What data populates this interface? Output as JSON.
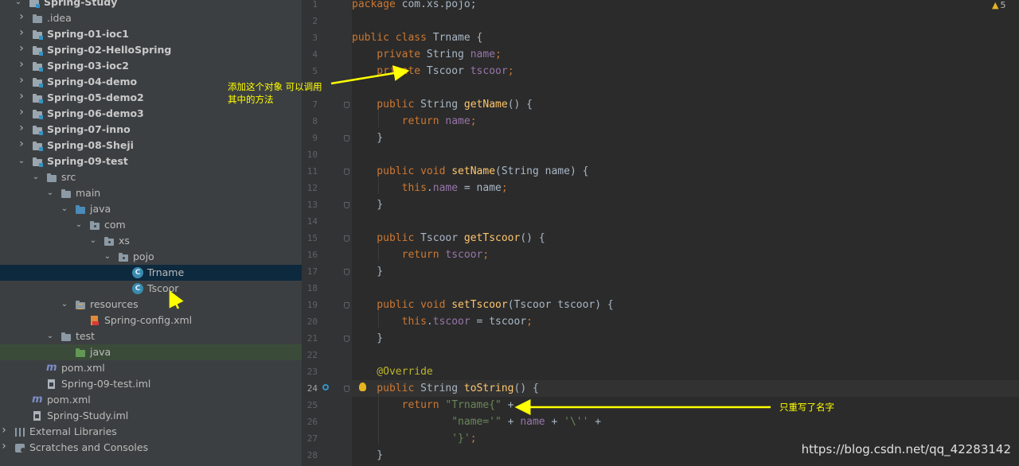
{
  "project_tree": {
    "rows": [
      {
        "label": "Spring-Study",
        "path": "C:\\Users\\相生\\IdeaProjects\\Spring-Study",
        "icon": "module-folder-icon",
        "chevron": "down",
        "bold": true
      },
      {
        "label": ".idea",
        "icon": "folder-icon",
        "chevron": "right"
      },
      {
        "label": "Spring-01-ioc1",
        "icon": "module-folder-icon",
        "chevron": "right",
        "bold": true
      },
      {
        "label": "Spring-02-HelloSpring",
        "icon": "module-folder-icon",
        "chevron": "right",
        "bold": true
      },
      {
        "label": "Spring-03-ioc2",
        "icon": "module-folder-icon",
        "chevron": "right",
        "bold": true
      },
      {
        "label": "Spring-04-demo",
        "icon": "module-folder-icon",
        "chevron": "right",
        "bold": true
      },
      {
        "label": "Spring-05-demo2",
        "icon": "module-folder-icon",
        "chevron": "right",
        "bold": true
      },
      {
        "label": "Spring-06-demo3",
        "icon": "module-folder-icon",
        "chevron": "right",
        "bold": true
      },
      {
        "label": "Spring-07-inno",
        "icon": "module-folder-icon",
        "chevron": "right",
        "bold": true
      },
      {
        "label": "Spring-08-Sheji",
        "icon": "module-folder-icon",
        "chevron": "right",
        "bold": true
      },
      {
        "label": "Spring-09-test",
        "icon": "module-folder-icon",
        "chevron": "down",
        "bold": true
      },
      {
        "label": "src",
        "icon": "folder-icon",
        "chevron": "down"
      },
      {
        "label": "main",
        "icon": "folder-icon",
        "chevron": "down"
      },
      {
        "label": "java",
        "icon": "source-folder-icon",
        "chevron": "down"
      },
      {
        "label": "com",
        "icon": "package-icon",
        "chevron": "down"
      },
      {
        "label": "xs",
        "icon": "package-icon",
        "chevron": "down"
      },
      {
        "label": "pojo",
        "icon": "package-icon",
        "chevron": "down"
      },
      {
        "label": "Trname",
        "icon": "class-icon",
        "selected": true
      },
      {
        "label": "Tscoor",
        "icon": "class-icon"
      },
      {
        "label": "resources",
        "icon": "resources-folder-icon",
        "chevron": "down"
      },
      {
        "label": "Spring-config.xml",
        "icon": "spring-xml-icon"
      },
      {
        "label": "test",
        "icon": "folder-icon",
        "chevron": "down"
      },
      {
        "label": "java",
        "icon": "test-folder-icon",
        "highlight": true
      },
      {
        "label": "pom.xml",
        "icon": "maven-icon"
      },
      {
        "label": "Spring-09-test.iml",
        "icon": "iml-file-icon"
      },
      {
        "label": "pom.xml",
        "icon": "maven-icon"
      },
      {
        "label": "Spring-Study.iml",
        "icon": "iml-file-icon"
      },
      {
        "label": "External Libraries",
        "icon": "libraries-icon",
        "chevron": "right"
      },
      {
        "label": "Scratches and Consoles",
        "icon": "scratches-icon",
        "chevron": "right"
      }
    ]
  },
  "editor": {
    "current_line": 24,
    "warnings_count": "5",
    "lines": [
      {
        "n": "1",
        "tokens": [
          [
            "kw",
            "package "
          ],
          [
            "plain",
            "com.xs.pojo;"
          ]
        ]
      },
      {
        "n": "2",
        "tokens": []
      },
      {
        "n": "3",
        "tokens": [
          [
            "kw",
            "public class "
          ],
          [
            "plain",
            "Trname {"
          ]
        ]
      },
      {
        "n": "4",
        "tokens": [
          [
            "kw",
            "    private "
          ],
          [
            "plain",
            "String "
          ],
          [
            "fld",
            "name"
          ],
          [
            "kw",
            ";"
          ]
        ]
      },
      {
        "n": "5",
        "tokens": [
          [
            "kw",
            "    private "
          ],
          [
            "plain",
            "Tscoor "
          ],
          [
            "fld",
            "tscoor"
          ],
          [
            "kw",
            ";"
          ]
        ]
      },
      {
        "n": "6",
        "tokens": []
      },
      {
        "n": "7",
        "tokens": [
          [
            "kw",
            "    public "
          ],
          [
            "plain",
            "String "
          ],
          [
            "mth",
            "getName"
          ],
          [
            "plain",
            "() {"
          ]
        ]
      },
      {
        "n": "8",
        "tokens": [
          [
            "kw",
            "        return "
          ],
          [
            "fld",
            "name"
          ],
          [
            "kw",
            ";"
          ]
        ]
      },
      {
        "n": "9",
        "tokens": [
          [
            "plain",
            "    }"
          ]
        ]
      },
      {
        "n": "10",
        "tokens": []
      },
      {
        "n": "11",
        "tokens": [
          [
            "kw",
            "    public void "
          ],
          [
            "mth",
            "setName"
          ],
          [
            "plain",
            "(String name) {"
          ]
        ]
      },
      {
        "n": "12",
        "tokens": [
          [
            "kw",
            "        this"
          ],
          [
            "plain",
            "."
          ],
          [
            "fld",
            "name"
          ],
          [
            "plain",
            " = name"
          ],
          [
            "kw",
            ";"
          ]
        ]
      },
      {
        "n": "13",
        "tokens": [
          [
            "plain",
            "    }"
          ]
        ]
      },
      {
        "n": "14",
        "tokens": []
      },
      {
        "n": "15",
        "tokens": [
          [
            "kw",
            "    public "
          ],
          [
            "plain",
            "Tscoor "
          ],
          [
            "mth",
            "getTscoor"
          ],
          [
            "plain",
            "() {"
          ]
        ]
      },
      {
        "n": "16",
        "tokens": [
          [
            "kw",
            "        return "
          ],
          [
            "fld",
            "tscoor"
          ],
          [
            "kw",
            ";"
          ]
        ]
      },
      {
        "n": "17",
        "tokens": [
          [
            "plain",
            "    }"
          ]
        ]
      },
      {
        "n": "18",
        "tokens": []
      },
      {
        "n": "19",
        "tokens": [
          [
            "kw",
            "    public void "
          ],
          [
            "mth",
            "setTscoor"
          ],
          [
            "plain",
            "(Tscoor tscoor) {"
          ]
        ]
      },
      {
        "n": "20",
        "tokens": [
          [
            "kw",
            "        this"
          ],
          [
            "plain",
            "."
          ],
          [
            "fld",
            "tscoor"
          ],
          [
            "plain",
            " = tscoor"
          ],
          [
            "kw",
            ";"
          ]
        ]
      },
      {
        "n": "21",
        "tokens": [
          [
            "plain",
            "    }"
          ]
        ]
      },
      {
        "n": "22",
        "tokens": []
      },
      {
        "n": "23",
        "tokens": [
          [
            "ann",
            "    @Override"
          ]
        ]
      },
      {
        "n": "24",
        "tokens": [
          [
            "kw",
            "    public "
          ],
          [
            "plain",
            "String "
          ],
          [
            "mth",
            "toString"
          ],
          [
            "plain",
            "() {"
          ]
        ]
      },
      {
        "n": "25",
        "tokens": [
          [
            "kw",
            "        return "
          ],
          [
            "str",
            "\"Trname{\""
          ],
          [
            "plain",
            " +"
          ]
        ]
      },
      {
        "n": "26",
        "tokens": [
          [
            "str",
            "                \"name='\""
          ],
          [
            "plain",
            " + "
          ],
          [
            "fld",
            "name"
          ],
          [
            "plain",
            " + "
          ],
          [
            "str",
            "'\\''"
          ],
          [
            "plain",
            " +"
          ]
        ]
      },
      {
        "n": "27",
        "tokens": [
          [
            "str",
            "                '}'"
          ],
          [
            "kw",
            ";"
          ]
        ]
      },
      {
        "n": "28",
        "tokens": [
          [
            "plain",
            "    }"
          ]
        ]
      }
    ]
  },
  "annotations": {
    "note1_line1": "添加这个对象 可以调用",
    "note1_line2": "其中的方法",
    "note2": "只重写了名字"
  },
  "watermark": "https://blog.csdn.net/qq_42283142",
  "colors": {
    "annotation": "#ffff00",
    "keyword": "#cc7832",
    "field": "#9876aa",
    "method": "#ffc66d",
    "string": "#6a8759",
    "annotation_code": "#bbb529"
  }
}
